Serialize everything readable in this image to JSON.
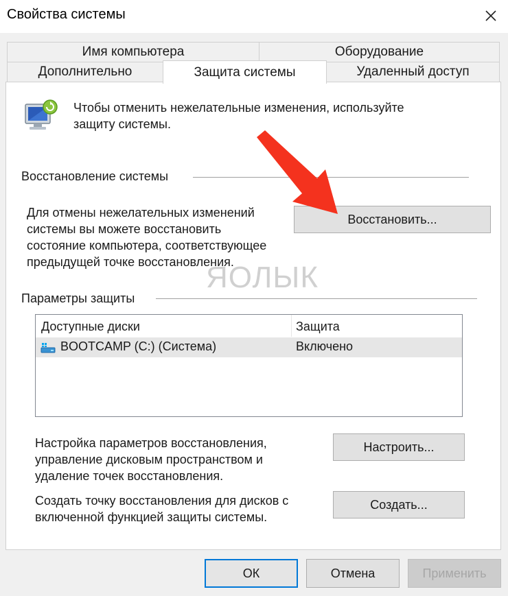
{
  "window": {
    "title": "Свойства системы"
  },
  "tabs": [
    {
      "label": "Имя компьютера"
    },
    {
      "label": "Оборудование"
    },
    {
      "label": "Дополнительно"
    },
    {
      "label": "Защита системы"
    },
    {
      "label": "Удаленный доступ"
    }
  ],
  "intro": {
    "text1": "Чтобы отменить нежелательные изменения, используйте",
    "text2": "защиту системы."
  },
  "restore": {
    "section_title": "Восстановление системы",
    "desc1": "Для отмены нежелательных изменений",
    "desc2": "системы вы можете восстановить",
    "desc3": "состояние компьютера, соответствующее",
    "desc4": "предыдущей точке восстановления.",
    "button": "Восстановить..."
  },
  "protection": {
    "section_title": "Параметры защиты",
    "columns": [
      "Доступные диски",
      "Защита"
    ],
    "rows": [
      {
        "drive": "BOOTCAMP (C:) (Система)",
        "status": "Включено"
      }
    ],
    "configure_text1": "Настройка параметров восстановления,",
    "configure_text2": "управление дисковым пространством и",
    "configure_text3": "удаление точек восстановления.",
    "configure_button": "Настроить...",
    "create_text1": "Создать точку восстановления для дисков с",
    "create_text2": "включенной функцией защиты системы.",
    "create_button": "Создать..."
  },
  "footer": {
    "ok": "ОК",
    "cancel": "Отмена",
    "apply": "Применить"
  },
  "watermark": "ЯОЛЫК",
  "colors": {
    "accent": "#0078d7",
    "arrow": "#f4321e"
  }
}
